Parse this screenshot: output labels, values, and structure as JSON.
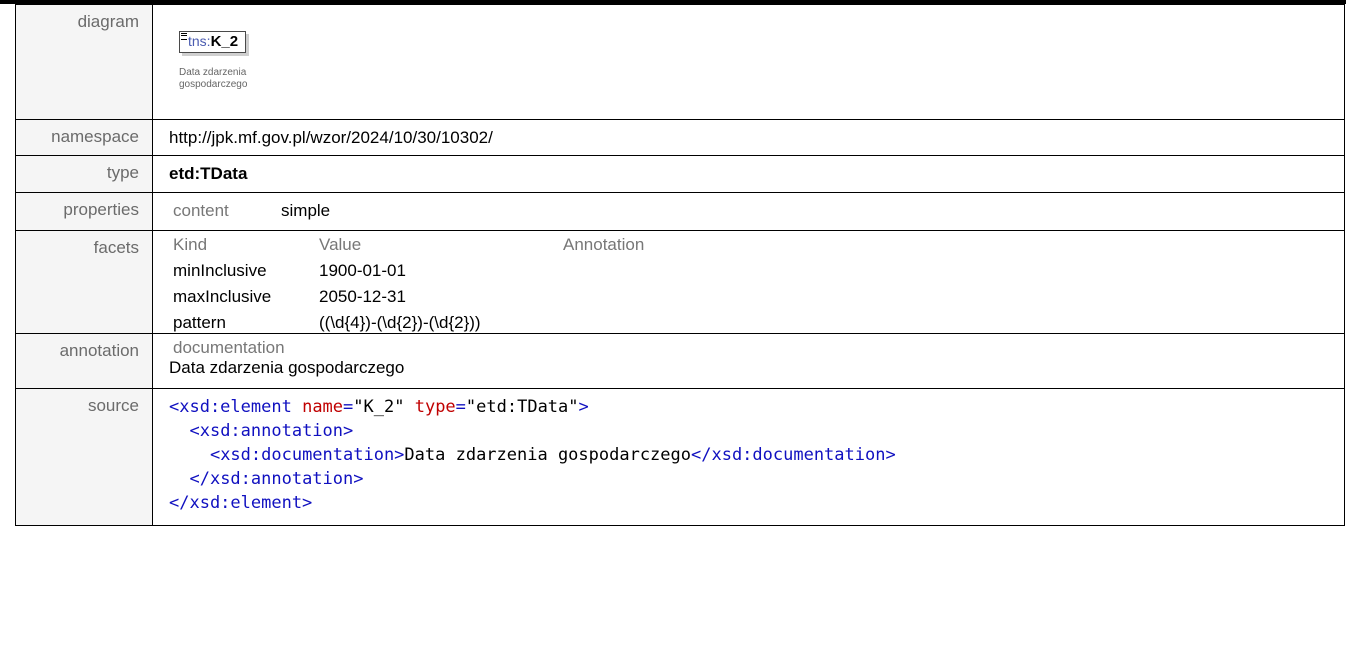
{
  "labels": {
    "diagram": "diagram",
    "namespace": "namespace",
    "type": "type",
    "properties": "properties",
    "facets": "facets",
    "annotation": "annotation",
    "source": "source"
  },
  "diagram": {
    "prefix": "tns:",
    "element_name": "K_2",
    "doc_text": "Data zdarzenia gospodarczego"
  },
  "namespace": "http://jpk.mf.gov.pl/wzor/2024/10/30/10302/",
  "type": "etd:TData",
  "properties": {
    "key": "content",
    "value": "simple"
  },
  "facets": {
    "headers": [
      "Kind",
      "Value",
      "Annotation"
    ],
    "rows": [
      {
        "kind": "minInclusive",
        "value": "1900-01-01"
      },
      {
        "kind": "maxInclusive",
        "value": "2050-12-31"
      },
      {
        "kind": "pattern",
        "value": "((\\d{4})-(\\d{2})-(\\d{2}))"
      }
    ]
  },
  "annotation": {
    "key": "documentation",
    "text": "Data zdarzenia gospodarczego"
  },
  "source": {
    "element_open": "<xsd:element",
    "name_attr": "name",
    "name_val": "\"K_2\"",
    "type_attr": "type",
    "type_val": "\"etd:TData\"",
    "gt": ">",
    "annotation_open": "<xsd:annotation>",
    "documentation_open": "<xsd:documentation>",
    "documentation_text": "Data zdarzenia gospodarczego",
    "documentation_close": "</xsd:documentation>",
    "annotation_close": "</xsd:annotation>",
    "element_close": "</xsd:element>"
  },
  "colors": {
    "tag": "#1010c0",
    "attr": "#c00000",
    "label_bg": "#f5f5f5"
  }
}
